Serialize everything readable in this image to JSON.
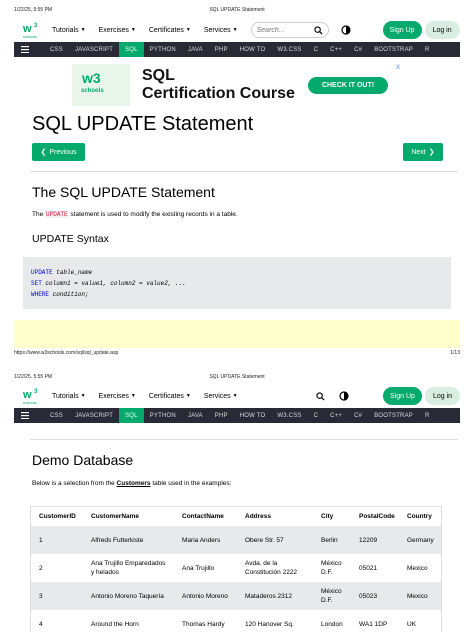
{
  "print": {
    "datetime": "1/22/25, 5:55 PM",
    "doc_title": "SQL UPDATE Statement",
    "url": "https://www.w3schools.com/sql/sql_update.asp",
    "page_num": "1/13"
  },
  "topnav": {
    "logo_alt": "w3schools",
    "items": [
      "Tutorials",
      "Exercises",
      "Certificates",
      "Services"
    ],
    "search_placeholder": "Search...",
    "signup": "Sign Up",
    "login": "Log in"
  },
  "langbar": {
    "items": [
      "CSS",
      "JAVASCRIPT",
      "SQL",
      "PYTHON",
      "JAVA",
      "PHP",
      "HOW TO",
      "W3.CSS",
      "C",
      "C++",
      "C#",
      "BOOTSTRAP",
      "R"
    ],
    "active": "SQL"
  },
  "ad": {
    "logo": "w3",
    "logo_sub": "schools",
    "title1": "SQL",
    "title2": "Certification Course",
    "cta": "CHECK IT OUT!",
    "close": "X"
  },
  "page": {
    "title": "SQL UPDATE Statement",
    "prev": "Previous",
    "next": "Next",
    "section_title": "The SQL UPDATE Statement",
    "intro_before": "The ",
    "intro_kw": "UPDATE",
    "intro_after": " statement is used to modify the existing records in a table.",
    "syntax_title": "UPDATE Syntax",
    "code": {
      "l1_kw": "UPDATE",
      "l1_rest": " table_name",
      "l2_kw": "SET",
      "l2_rest": " column1 = value1, column2 = value2, ...",
      "l3_kw": "WHERE",
      "l3_rest": " condition;"
    }
  },
  "page2": {
    "title": "Demo Database",
    "intro_before": "Below is a selection from the ",
    "intro_link": "Customers",
    "intro_after": " table used in the examples:",
    "columns": [
      "CustomerID",
      "CustomerName",
      "ContactName",
      "Address",
      "City",
      "PostalCode",
      "Country"
    ],
    "rows": [
      [
        "1",
        "Alfreds Futterkiste",
        "Maria Anders",
        "Obere Str. 57",
        "Berlin",
        "12209",
        "Germany"
      ],
      [
        "2",
        "Ana Trujillo Emparedados y helados",
        "Ana Trujillo",
        "Avda. de la Constitución 2222",
        "México D.F.",
        "05021",
        "Mexico"
      ],
      [
        "3",
        "Antonio Moreno Taquería",
        "Antonio Moreno",
        "Mataderos 2312",
        "México D.F.",
        "05023",
        "Mexico"
      ],
      [
        "4",
        "Around the Horn",
        "Thomas Hardy",
        "120 Hanover Sq.",
        "London",
        "WA1 1DP",
        "UK"
      ]
    ]
  },
  "colors": {
    "brand_green": "#04aa6d",
    "dark_bar": "#282a35",
    "code_bg": "#e7e9eb",
    "keyword_red": "#dc143c"
  }
}
